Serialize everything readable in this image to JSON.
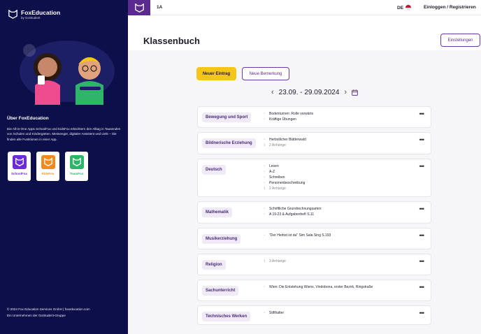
{
  "sidebar": {
    "brand": "FoxEducation",
    "brand_sub": "by GoStudent",
    "about_title": "Über FoxEducation",
    "about_text": "Die All-in-One Apps SchoolFox und KidsFox erleichtern den Alltag in Tausenden von Schulen und Kindergärten. Messenger, digitaler Assistent und LMS – Sie finden alle Funktionen in einer App.",
    "apps": [
      {
        "name": "SchoolFox",
        "color": "#6c2bd9"
      },
      {
        "name": "KidsFox",
        "color": "#f28a1c"
      },
      {
        "name": "TeamFox",
        "color": "#2fb56a"
      }
    ],
    "footer_line1": "© 2024 Fox Education Services GmbH | foxeducation.com",
    "footer_line2": "Ein Unternehmen der GoStudent-Gruppe"
  },
  "topbar": {
    "class_name": "1A",
    "language": "DE",
    "login": "Einloggen / Registrieren"
  },
  "page": {
    "title": "Klassenbuch",
    "settings_label": "Einstellungen",
    "new_entry_label": "Neuer Eintrag",
    "new_note_label": "Neue Bemerkung",
    "week": "23.09. - 29.09.2024",
    "prev_icon": "‹",
    "next_icon": "›"
  },
  "rows": [
    {
      "subject": "Bewegung und Sport",
      "entries": [
        "Bodenturnen: Rolle vorwärts",
        "Kräftige Übungen"
      ],
      "attachments": ""
    },
    {
      "subject": "Bildnerische Erziehung",
      "entries": [
        "Herbstlicher Blätterwald"
      ],
      "attachments": "2 Anhänge"
    },
    {
      "subject": "Deutsch",
      "entries": [
        "Lesen",
        "A-Z",
        "Schreiben",
        "Personenbeschreibung"
      ],
      "attachments": "2 Anhänge"
    },
    {
      "subject": "Mathematik",
      "entries": [
        "Schriftliche Grundrechnungsarten",
        "A 19-23 & Aufgabenheft S.11"
      ],
      "attachments": ""
    },
    {
      "subject": "Musikerziehung",
      "entries": [
        "\"Der Herbst ist da\" Sim Sala Sing S.193"
      ],
      "attachments": ""
    },
    {
      "subject": "Religion",
      "entries": [],
      "attachments": "3 Anhänge"
    },
    {
      "subject": "Sachunterricht",
      "entries": [
        "Wien: Die Entstehung Wiens, Vindobona, erster Bezirk, Ringstraße"
      ],
      "attachments": ""
    },
    {
      "subject": "Technisches Werken",
      "entries": [
        "Stifthalter"
      ],
      "attachments": ""
    }
  ]
}
